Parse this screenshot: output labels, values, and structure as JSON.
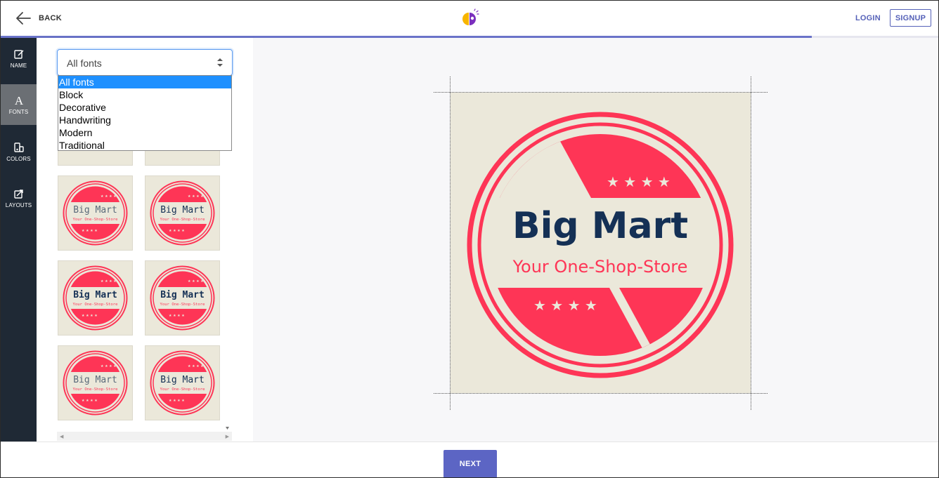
{
  "header": {
    "back_label": "BACK",
    "login_label": "LOGIN",
    "signup_label": "SIGNUP",
    "progress_fraction": 0.865
  },
  "sidebar": {
    "items": [
      {
        "label": "NAME",
        "icon": "edit-icon",
        "active": false
      },
      {
        "label": "FONTS",
        "icon": "font-icon",
        "active": true
      },
      {
        "label": "COLORS",
        "icon": "palette-icon",
        "active": false
      },
      {
        "label": "LAYOUTS",
        "icon": "layout-icon",
        "active": false
      }
    ]
  },
  "font_filter": {
    "selected": "All fonts",
    "options": [
      "All fonts",
      "Block",
      "Decorative",
      "Handwriting",
      "Modern",
      "Traditional"
    ]
  },
  "logo": {
    "brand": "Big Mart",
    "tagline": "Your One-Shop-Store"
  },
  "thumbnails": [
    {
      "brand": "Big Mart",
      "tagline": "Your One-Shop-Store",
      "font": "mono-light"
    },
    {
      "brand": "Big Mart",
      "tagline": "Your One-Shop-Store",
      "font": "mono"
    },
    {
      "brand": "Big Mart",
      "tagline": "Your One-Shop-Store",
      "font": "mono-bold"
    },
    {
      "brand": "Big Mart",
      "tagline": "Your One-Shop-Store",
      "font": "mono-bold"
    },
    {
      "brand": "Big Mart",
      "tagline": "Your One-Shop-Store",
      "font": "mono-light"
    },
    {
      "brand": "Big Mart",
      "tagline": "Your One-Shop-Store",
      "font": "mono"
    }
  ],
  "colors": {
    "accent": "#5c65c4",
    "logo_red": "#fe3556",
    "logo_navy": "#143055",
    "logo_bg": "#ebe8da",
    "sidebar_bg": "#1f2935"
  },
  "footer": {
    "next_label": "NEXT"
  }
}
